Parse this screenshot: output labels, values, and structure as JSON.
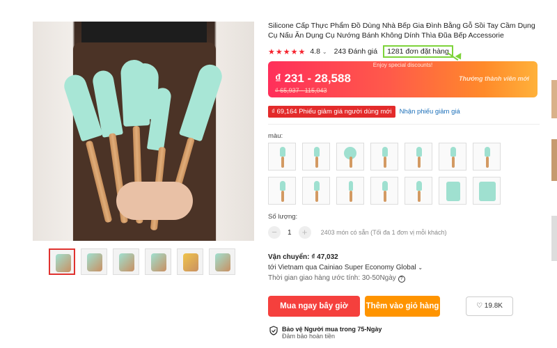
{
  "product": {
    "title": "Silicone Cấp Thực Phẩm Đồ Dùng Nhà Bếp Gia Đình Bằng Gỗ Sồi Tay Cầm Dụng Cụ Nấu Ăn Dụng Cụ Nướng Bánh Không Dính Thìa Đũa Bếp Accessorie",
    "stars": "★★★★★",
    "rating": "4.8",
    "reviews": "243 Đánh giá",
    "orders": "1281 đơn đặt hàng"
  },
  "price": {
    "promo": "Enjoy special discounts!",
    "current": "₫ 231 - 28,588",
    "original": "₫ 65,937 - 115,043",
    "new_user": "Thưởng thành viên mới"
  },
  "coupon": {
    "badge": "₫ 69,164 Phiếu giảm giá người dùng mới",
    "link": "Nhận phiếu giảm giá"
  },
  "options": {
    "color_label": "màu:",
    "quantity_label": "Số lượng:",
    "quantity_value": "1",
    "minus": "−",
    "plus": "+",
    "stock": "2403 món có sẵn (Tối đa 1 đơn vị mỗi khách)"
  },
  "shipping": {
    "label": "Vận chuyển: ",
    "price": "₫ 47,032",
    "route": "tới Vietnam qua Cainiao Super Economy Global",
    "time": "Thời gian giao hàng ước tính: 30-50Ngày"
  },
  "actions": {
    "buy_now": "Mua ngay bây giờ",
    "add_cart": "Thêm vào giỏ hàng",
    "wishlist": "19.8K"
  },
  "protection": {
    "title": "Bảo vệ Người mua trong 75-Ngày",
    "subtitle": "Đảm bảo hoàn tiền"
  },
  "icons": {
    "heart": "heart-icon",
    "shield": "shield-icon",
    "info": "info-icon",
    "chevron": "chevron-down-icon"
  }
}
